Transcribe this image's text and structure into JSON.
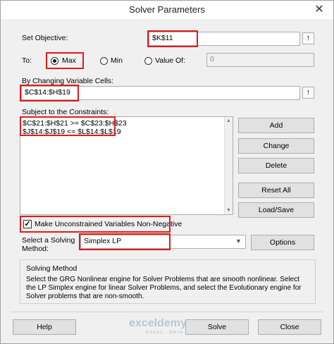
{
  "window": {
    "title": "Solver Parameters",
    "close_glyph": "✕"
  },
  "objective": {
    "label": "Set Objective:",
    "value": "$K$11"
  },
  "to": {
    "label": "To:",
    "options": [
      {
        "label": "Max",
        "selected": true
      },
      {
        "label": "Min",
        "selected": false
      },
      {
        "label": "Value Of:",
        "selected": false
      }
    ],
    "value_of": "0"
  },
  "changing": {
    "label": "By Changing Variable Cells:",
    "value": "$C$14:$H$19"
  },
  "constraints": {
    "label": "Subject to the Constraints:",
    "items": [
      "$C$21:$H$21 >= $C$23:$H$23",
      "$J$14:$J$19 <= $L$14:$L$19"
    ]
  },
  "buttons": {
    "add": "Add",
    "change": "Change",
    "delete": "Delete",
    "reset_all": "Reset All",
    "load_save": "Load/Save",
    "options": "Options",
    "help": "Help",
    "solve": "Solve",
    "close": "Close"
  },
  "nonneg": {
    "label": "Make Unconstrained Variables Non-Negative",
    "checked": true
  },
  "method": {
    "label_line1": "Select a Solving",
    "label_line2": "Method:",
    "value": "Simplex LP"
  },
  "solving_method": {
    "title": "Solving Method",
    "text": "Select the GRG Nonlinear engine for Solver Problems that are smooth nonlinear. Select the LP Simplex engine for linear Solver Problems, and select the Evolutionary engine for Solver problems that are non-smooth."
  },
  "watermark": {
    "brand": "exceldemy",
    "tagline": "EXCEL · DATA · BI"
  },
  "accent": "#e01b1b",
  "icons": {
    "ref_picker": "collapse-up-arrow-icon",
    "dropdown": "chevron-down-icon",
    "check": "checkmark-icon"
  }
}
